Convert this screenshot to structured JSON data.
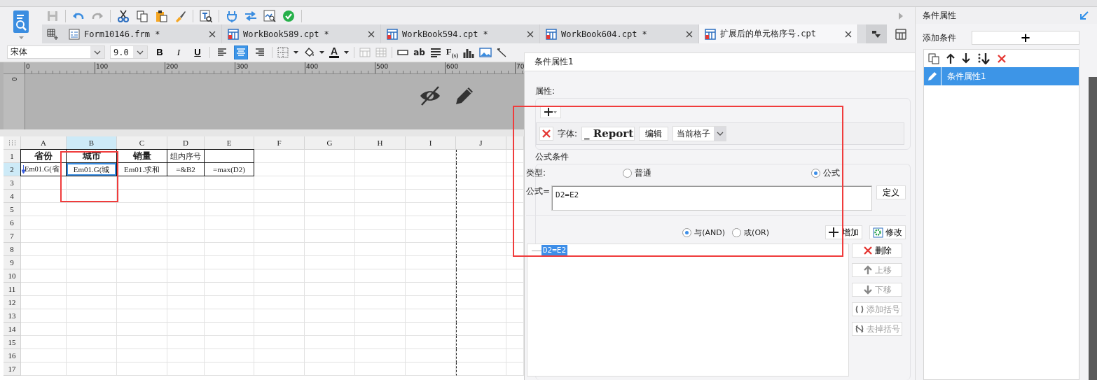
{
  "tabs": [
    {
      "label": "Form10146.frm *",
      "kind": "form",
      "selected": false
    },
    {
      "label": "WorkBook589.cpt *",
      "kind": "report",
      "selected": false
    },
    {
      "label": "WorkBook594.cpt *",
      "kind": "report",
      "selected": false
    },
    {
      "label": "WorkBook604.cpt *",
      "kind": "report",
      "selected": false
    },
    {
      "label": "扩展后的单元格序号.cpt",
      "kind": "report",
      "selected": true
    }
  ],
  "format_bar": {
    "font": "宋体",
    "size": "9.0",
    "style_buttons": [
      "B",
      "I",
      "U"
    ],
    "alignments": [
      {
        "selected": false
      },
      {
        "selected": true
      },
      {
        "selected": false
      }
    ],
    "font_color_glyph": "A",
    "text_tool_glyph": "ab",
    "formula_tool_glyph": "F$_{(x)}$"
  },
  "ruler": {
    "top_ticks": [
      "0",
      "100",
      "200",
      "300",
      "400",
      "500",
      "600",
      "70"
    ],
    "side_ticks": [
      "0"
    ]
  },
  "sheet": {
    "columns": [
      {
        "label": "A",
        "selected": false
      },
      {
        "label": "B",
        "selected": true
      },
      {
        "label": "C",
        "selected": false
      },
      {
        "label": "D",
        "selected": false
      },
      {
        "label": "E",
        "selected": false
      },
      {
        "label": "F",
        "selected": false
      },
      {
        "label": "G",
        "selected": false
      },
      {
        "label": "H",
        "selected": false
      },
      {
        "label": "I",
        "selected": false
      },
      {
        "label": "J",
        "selected": false
      }
    ],
    "rows": [
      {
        "label": "1",
        "selected": false,
        "cells": [
          {
            "text": "省份",
            "bold": true,
            "selected": false
          },
          {
            "text": "城市",
            "bold": true,
            "selected": false
          },
          {
            "text": "销量",
            "bold": true,
            "selected": false
          },
          {
            "text": "组内序号",
            "bold": false,
            "selected": false
          },
          {
            "selected": false
          }
        ]
      },
      {
        "label": "2",
        "selected": true,
        "cells": [
          {
            "text": "Em01.G(省",
            "bold": false,
            "selected": false,
            "expand": true
          },
          {
            "text": "Em01.G(城",
            "bold": false,
            "selected": true
          },
          {
            "text": "Em01.求和",
            "bold": false,
            "selected": false
          },
          {
            "text": "=&B2",
            "bold": false,
            "selected": false
          },
          {
            "text": "=max(D2)",
            "bold": false,
            "selected": false
          }
        ]
      },
      {
        "label": "3",
        "selected": false
      },
      {
        "label": "4",
        "selected": false
      },
      {
        "label": "5",
        "selected": false
      },
      {
        "label": "6",
        "selected": false
      },
      {
        "label": "7",
        "selected": false
      },
      {
        "label": "8",
        "selected": false
      },
      {
        "label": "9",
        "selected": false
      },
      {
        "label": "10",
        "selected": false
      },
      {
        "label": "11",
        "selected": false
      },
      {
        "label": "12",
        "selected": false
      },
      {
        "label": "13",
        "selected": false
      },
      {
        "label": "14",
        "selected": false
      },
      {
        "label": "15",
        "selected": false
      },
      {
        "label": "16",
        "selected": false
      },
      {
        "label": "17",
        "selected": false
      }
    ]
  },
  "dialog": {
    "title": "条件属性1",
    "attributes_label": "属性:",
    "attribute": {
      "label": "字体:",
      "preview": "_ Report",
      "edit_button": "编辑",
      "scope": "当前格子"
    },
    "condition_title": "公式条件",
    "type_label": "类型:",
    "types": [
      {
        "label": "普通",
        "selected": false
      },
      {
        "label": "公式",
        "selected": true
      }
    ],
    "formula_label": "公式=",
    "formula": "D2=E2",
    "define_button": "定义",
    "joins": [
      {
        "label": "与(AND)",
        "selected": true
      },
      {
        "label": "或(OR)",
        "selected": false
      }
    ],
    "add_button": "增加",
    "modify_button": "修改",
    "conditions": [
      {
        "text": "D2=E2",
        "selected": true
      }
    ],
    "list_buttons": [
      {
        "label": "删除",
        "kind": "delete",
        "disabled": false
      },
      {
        "label": "上移",
        "kind": "up",
        "disabled": true
      },
      {
        "label": "下移",
        "kind": "down",
        "disabled": true
      },
      {
        "label": "添加括号",
        "kind": "bracket",
        "disabled": true
      },
      {
        "label": "去掉括号",
        "kind": "unbracket",
        "disabled": true
      }
    ]
  },
  "side_panel": {
    "title": "条件属性",
    "add_label": "添加条件",
    "add_button": "+",
    "items": [
      {
        "label": "条件属性1",
        "selected": true
      }
    ]
  }
}
